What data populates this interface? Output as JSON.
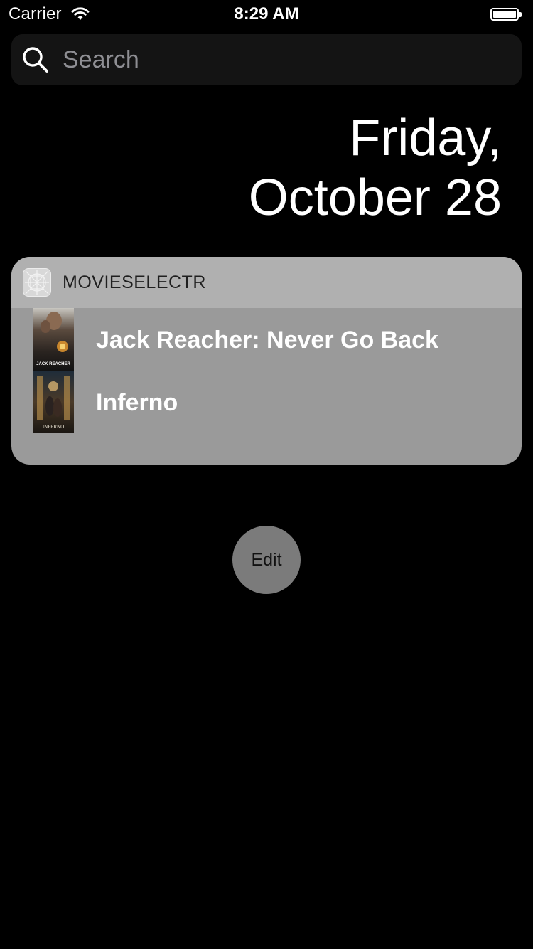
{
  "status_bar": {
    "carrier": "Carrier",
    "time": "8:29 AM",
    "battery_percent": 100
  },
  "search": {
    "placeholder": "Search",
    "value": ""
  },
  "date": {
    "line1": "Friday,",
    "line2": "October 28"
  },
  "widget": {
    "app_name": "MOVIESELECTR",
    "movies": [
      {
        "title": "Jack Reacher: Never Go Back",
        "poster_text": "JACK REACHER"
      },
      {
        "title": "Inferno",
        "poster_text": "INFERNO"
      }
    ]
  },
  "edit_button": {
    "label": "Edit"
  },
  "colors": {
    "background": "#000000",
    "widget_body": "#9a9a9a",
    "widget_header": "#b0b0b0",
    "edit_button": "#7b7b7b",
    "search_bg": "#141414"
  }
}
